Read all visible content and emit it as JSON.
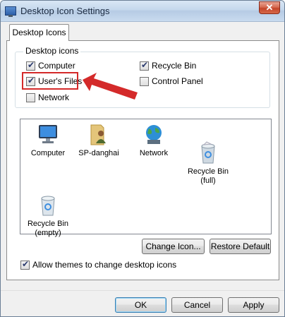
{
  "window": {
    "title": "Desktop Icon Settings",
    "close_label": "✕"
  },
  "tabs": [
    {
      "label": "Desktop Icons"
    }
  ],
  "group": {
    "title": "Desktop icons",
    "checkboxes": [
      {
        "label": "Computer",
        "checked": true
      },
      {
        "label": "User's Files",
        "checked": true
      },
      {
        "label": "Network",
        "checked": false
      },
      {
        "label": "Recycle Bin",
        "checked": true
      },
      {
        "label": "Control Panel",
        "checked": false
      }
    ]
  },
  "icons": [
    {
      "label": "Computer",
      "icon": "computer-icon"
    },
    {
      "label": "SP-danghai",
      "icon": "user-folder-icon"
    },
    {
      "label": "Network",
      "icon": "network-globe-icon"
    },
    {
      "label": "Recycle Bin\n(full)",
      "icon": "recycle-bin-full-icon"
    },
    {
      "label": "Recycle Bin\n(empty)",
      "icon": "recycle-bin-empty-icon"
    }
  ],
  "buttons": {
    "change_icon": "Change Icon...",
    "restore_default": "Restore Default",
    "ok": "OK",
    "cancel": "Cancel",
    "apply": "Apply"
  },
  "allow_themes": {
    "label": "Allow themes to change desktop icons",
    "checked": true
  },
  "colors": {
    "annotation_red": "#d42a2a"
  }
}
